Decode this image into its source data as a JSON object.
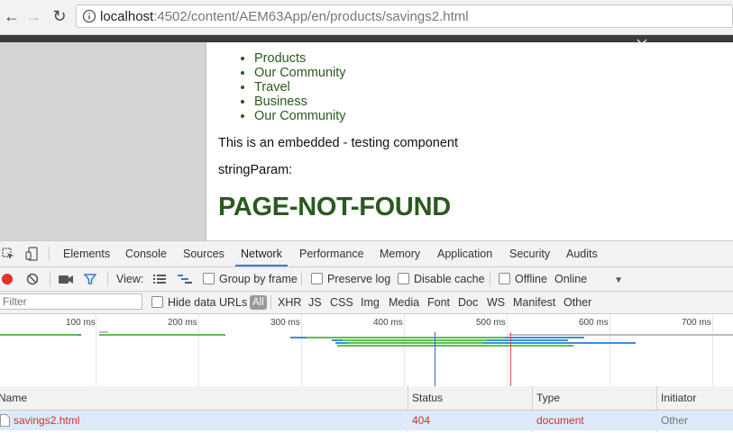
{
  "browser": {
    "url_host": "localhost",
    "url_rest": ":4502/content/AEM63App/en/products/savings2.html"
  },
  "page": {
    "nav_items": [
      "Products",
      "Our Community",
      "Travel",
      "Business",
      "Our Community"
    ],
    "embedded_text": "This is an embedded - testing component",
    "string_param_label": "stringParam:",
    "heading": "PAGE-NOT-FOUND",
    "heading_color": "#2a5a1f"
  },
  "devtools": {
    "tabs": [
      "Elements",
      "Console",
      "Sources",
      "Network",
      "Performance",
      "Memory",
      "Application",
      "Security",
      "Audits"
    ],
    "active_tab": "Network",
    "toolbar": {
      "view_label": "View:",
      "group_by_frame": "Group by frame",
      "preserve_log": "Preserve log",
      "disable_cache": "Disable cache",
      "offline": "Offline",
      "throttle": "Online"
    },
    "filter": {
      "placeholder": "Filter",
      "hide_data_urls": "Hide data URLs",
      "types": [
        "All",
        "XHR",
        "JS",
        "CSS",
        "Img",
        "Media",
        "Font",
        "Doc",
        "WS",
        "Manifest",
        "Other"
      ]
    },
    "timeline_ticks": [
      "100 ms",
      "200 ms",
      "300 ms",
      "400 ms",
      "500 ms",
      "600 ms",
      "700 ms"
    ],
    "columns": [
      "Name",
      "Status",
      "Type",
      "Initiator"
    ],
    "rows": [
      {
        "name": "savings2.html",
        "status": "404",
        "type": "document",
        "initiator": "Other"
      }
    ],
    "error_color": "#d32f2f"
  }
}
